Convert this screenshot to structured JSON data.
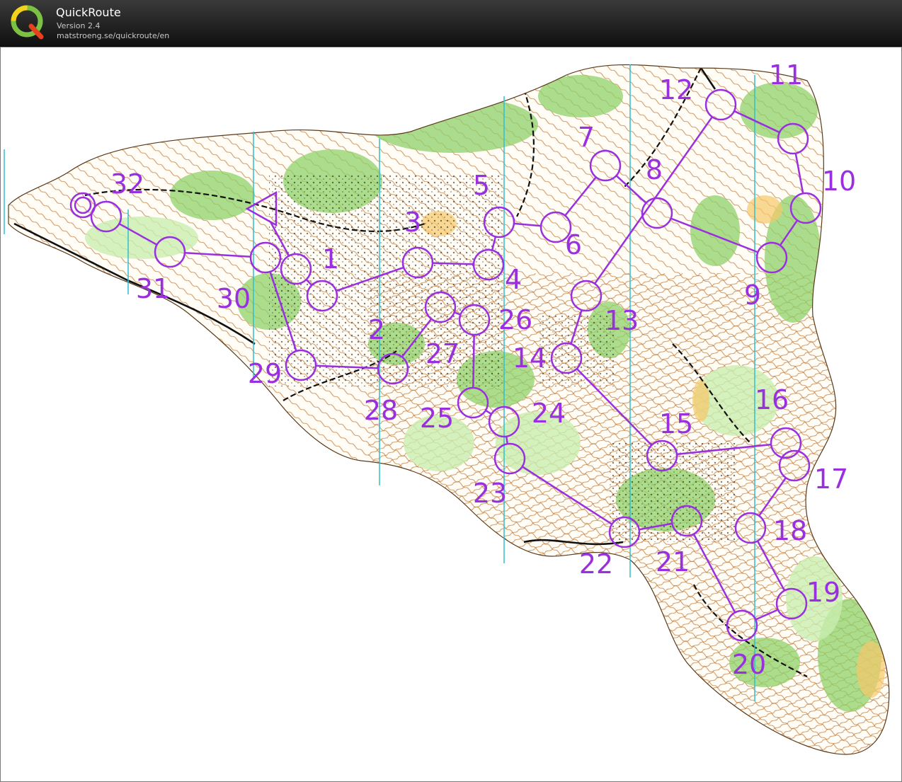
{
  "app": {
    "title": "QuickRoute",
    "version": "Version 2.4",
    "url": "matstroeng.se/quickroute/en"
  },
  "colors": {
    "course": "#9a2fe0",
    "vegetation": "#8fd16a",
    "open_land": "#f7c76a",
    "contours": "#b5651d",
    "north_lines": "#2fbfcf",
    "paper": "#ffffff",
    "titlebar": "#1a1a1a"
  },
  "icons": {
    "logo": "quickroute-q-logo",
    "start": "start-triangle",
    "finish": "finish-double-circle"
  },
  "map": {
    "controls": [
      {
        "label": "1"
      },
      {
        "label": "2"
      },
      {
        "label": "3"
      },
      {
        "label": "4"
      },
      {
        "label": "5"
      },
      {
        "label": "6"
      },
      {
        "label": "7"
      },
      {
        "label": "8"
      },
      {
        "label": "9"
      },
      {
        "label": "10"
      },
      {
        "label": "11"
      },
      {
        "label": "12"
      },
      {
        "label": "13"
      },
      {
        "label": "14"
      },
      {
        "label": "15"
      },
      {
        "label": "16"
      },
      {
        "label": "17"
      },
      {
        "label": "18"
      },
      {
        "label": "19"
      },
      {
        "label": "20"
      },
      {
        "label": "21"
      },
      {
        "label": "22"
      },
      {
        "label": "23"
      },
      {
        "label": "24"
      },
      {
        "label": "25"
      },
      {
        "label": "26"
      },
      {
        "label": "27"
      },
      {
        "label": "28"
      },
      {
        "label": "29"
      },
      {
        "label": "30"
      },
      {
        "label": "31"
      },
      {
        "label": "32"
      }
    ]
  }
}
